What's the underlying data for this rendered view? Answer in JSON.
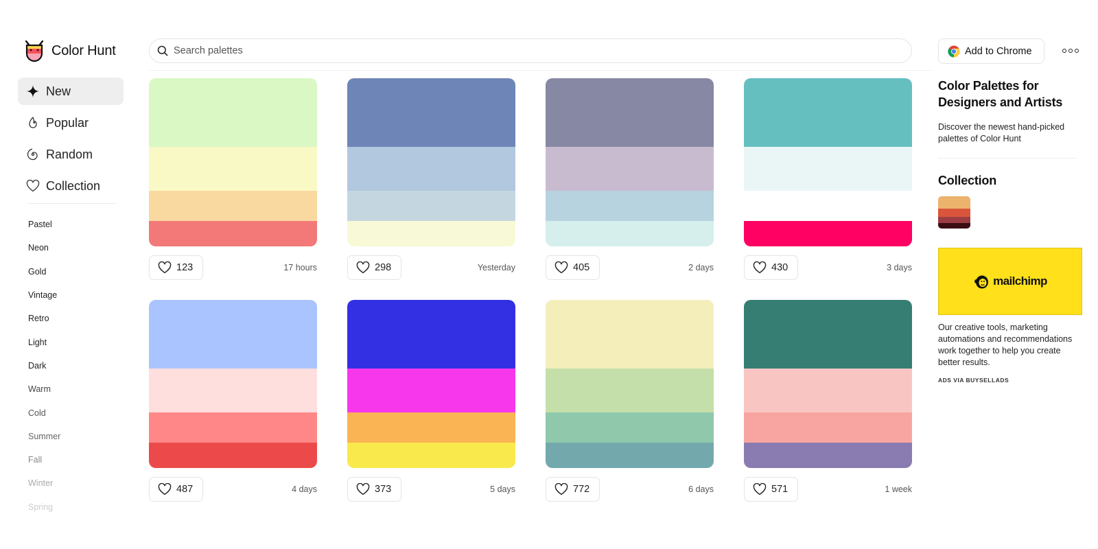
{
  "app": {
    "logo_text": "Color Hunt"
  },
  "search": {
    "placeholder": "Search palettes"
  },
  "header": {
    "chrome_button_label": "Add to Chrome"
  },
  "nav": [
    {
      "label": "New",
      "icon": "sparkle-icon",
      "active": true
    },
    {
      "label": "Popular",
      "icon": "flame-icon",
      "active": false
    },
    {
      "label": "Random",
      "icon": "spiral-icon",
      "active": false
    },
    {
      "label": "Collection",
      "icon": "heart-icon",
      "active": false
    }
  ],
  "tags": [
    {
      "label": "Pastel",
      "color": "#222222"
    },
    {
      "label": "Neon",
      "color": "#222222"
    },
    {
      "label": "Gold",
      "color": "#222222"
    },
    {
      "label": "Vintage",
      "color": "#222222"
    },
    {
      "label": "Retro",
      "color": "#222222"
    },
    {
      "label": "Light",
      "color": "#222222"
    },
    {
      "label": "Dark",
      "color": "#222222"
    },
    {
      "label": "Warm",
      "color": "#444444"
    },
    {
      "label": "Cold",
      "color": "#555555"
    },
    {
      "label": "Summer",
      "color": "#666666"
    },
    {
      "label": "Fall",
      "color": "#888888"
    },
    {
      "label": "Winter",
      "color": "#aaaaaa"
    },
    {
      "label": "Spring",
      "color": "#cccccc"
    }
  ],
  "palettes": [
    {
      "colors": [
        "#d9f8c4",
        "#f9f9c5",
        "#fad9a1",
        "#f37878"
      ],
      "likes": "123",
      "time": "17 hours"
    },
    {
      "colors": [
        "#6e85b7",
        "#b2c8df",
        "#c4d7e0",
        "#f8f9d7"
      ],
      "likes": "298",
      "time": "Yesterday"
    },
    {
      "colors": [
        "#8788a4",
        "#c9bbcf",
        "#b7d3df",
        "#d6efed"
      ],
      "likes": "405",
      "time": "2 days"
    },
    {
      "colors": [
        "#66bfbf",
        "#eaf6f6",
        "#ffffff",
        "#ff0063"
      ],
      "likes": "430",
      "time": "3 days"
    },
    {
      "colors": [
        "#aac4ff",
        "#ffdede",
        "#ff8787",
        "#ec4a4a"
      ],
      "likes": "487",
      "time": "4 days"
    },
    {
      "colors": [
        "#332fe3",
        "#f637ec",
        "#fbb454",
        "#f9e94c"
      ],
      "likes": "373",
      "time": "5 days"
    },
    {
      "colors": [
        "#f4efba",
        "#c4dfaa",
        "#90c8ac",
        "#73a9ad"
      ],
      "likes": "772",
      "time": "6 days"
    },
    {
      "colors": [
        "#367e73",
        "#f9c5c3",
        "#f8a5a2",
        "#8a7bb0"
      ],
      "likes": "571",
      "time": "1 week"
    }
  ],
  "right": {
    "title": "Color Palettes for Designers and Artists",
    "description": "Discover the newest hand-picked palettes of Color Hunt",
    "collection_title": "Collection",
    "collection_colors": [
      "#ebb36c",
      "#d9553b",
      "#9e3d44",
      "#3c0d13"
    ],
    "ad_brand": "mailchimp",
    "ad_text": "Our creative tools, marketing automations and recommendations work together to help you create better results.",
    "ads_via": "ADS VIA BUYSELLADS"
  }
}
